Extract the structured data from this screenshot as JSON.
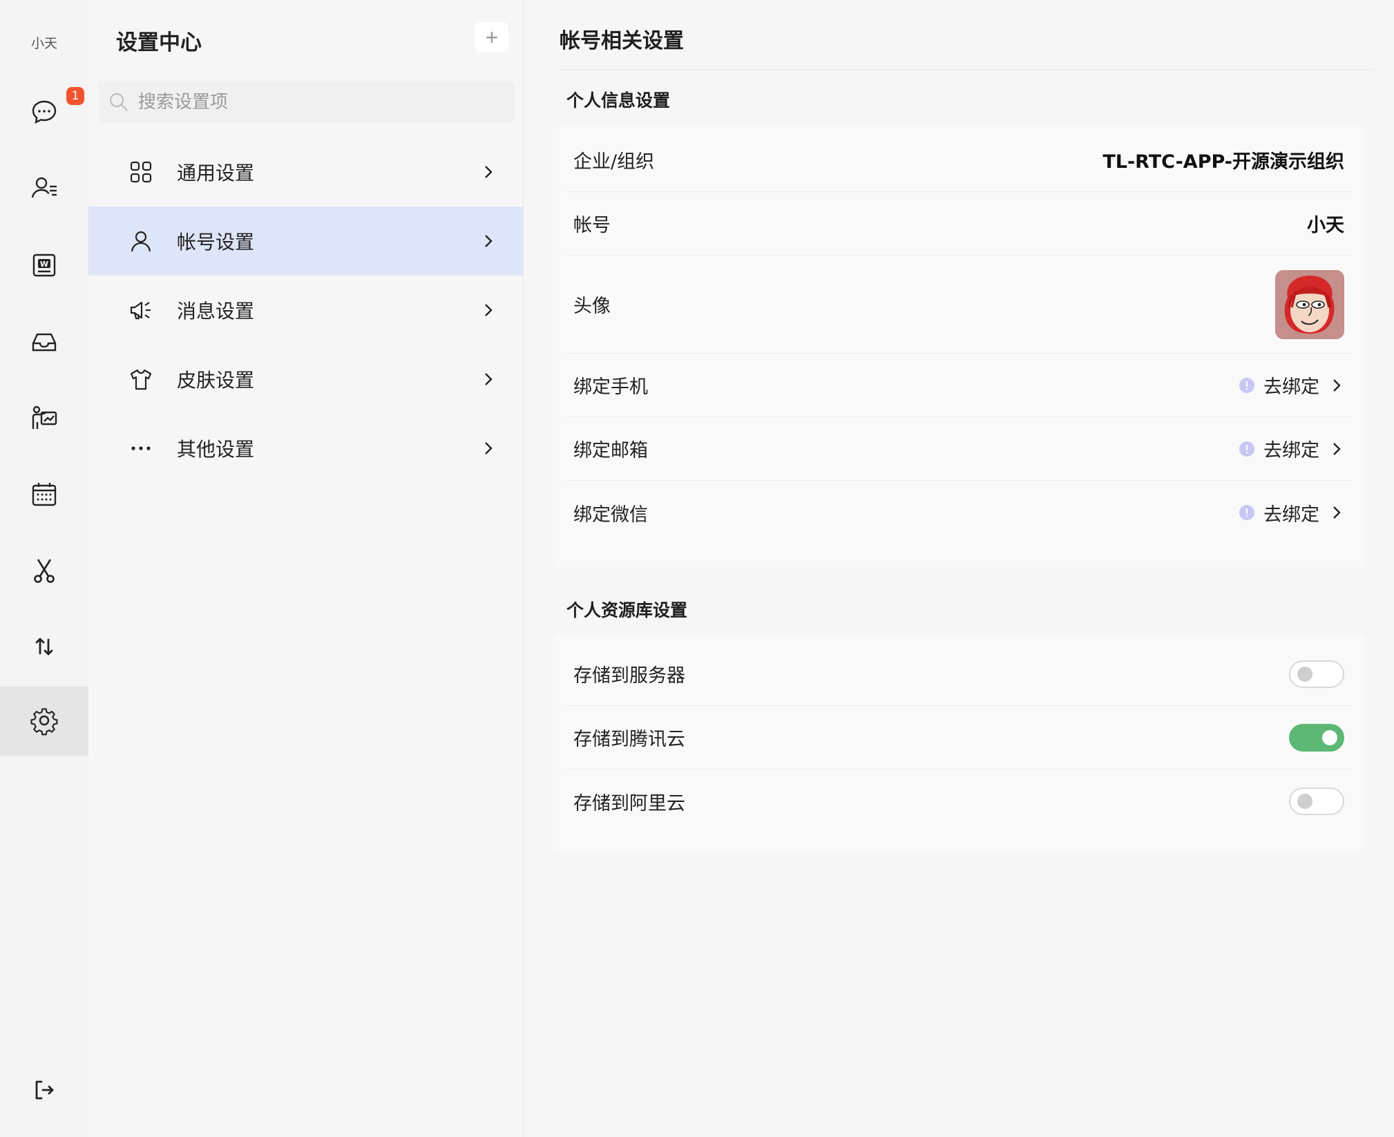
{
  "rail": {
    "user_name": "小天",
    "badge_count": "1",
    "items": [
      {
        "icon": "chat-icon"
      },
      {
        "icon": "contacts-icon"
      },
      {
        "icon": "word-doc-icon"
      },
      {
        "icon": "inbox-icon"
      },
      {
        "icon": "presentation-icon"
      },
      {
        "icon": "calendar-icon"
      },
      {
        "icon": "scissors-icon"
      },
      {
        "icon": "transfer-icon"
      },
      {
        "icon": "gear-icon",
        "active": true
      }
    ],
    "logout_icon": "logout-icon"
  },
  "menu": {
    "title": "设置中心",
    "add_label": "+",
    "search_placeholder": "搜索设置项",
    "items": [
      {
        "label": "通用设置",
        "icon": "grid-icon"
      },
      {
        "label": "帐号设置",
        "icon": "user-icon",
        "active": true
      },
      {
        "label": "消息设置",
        "icon": "megaphone-icon"
      },
      {
        "label": "皮肤设置",
        "icon": "shirt-icon"
      },
      {
        "label": "其他设置",
        "icon": "more-dots-icon"
      }
    ]
  },
  "content": {
    "title": "帐号相关设置",
    "personal": {
      "title": "个人信息设置",
      "org_label": "企业/组织",
      "org_value": "TL-RTC-APP-开源演示组织",
      "account_label": "帐号",
      "account_value": "小天",
      "avatar_label": "头像",
      "bindings": [
        {
          "label": "绑定手机",
          "action": "去绑定"
        },
        {
          "label": "绑定邮箱",
          "action": "去绑定"
        },
        {
          "label": "绑定微信",
          "action": "去绑定"
        }
      ]
    },
    "storage": {
      "title": "个人资源库设置",
      "options": [
        {
          "label": "存储到服务器",
          "enabled": false
        },
        {
          "label": "存储到腾讯云",
          "enabled": true
        },
        {
          "label": "存储到阿里云",
          "enabled": false
        }
      ]
    }
  },
  "colors": {
    "accent_selected": "#dfe5f8",
    "badge": "#f2532d",
    "toggle_on": "#5cb874",
    "info_dot": "#c9c6f3"
  }
}
